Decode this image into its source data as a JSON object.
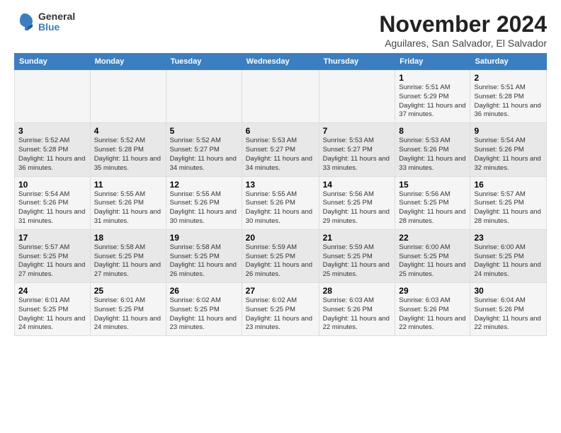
{
  "header": {
    "logo_general": "General",
    "logo_blue": "Blue",
    "month_title": "November 2024",
    "subtitle": "Aguilares, San Salvador, El Salvador"
  },
  "days_of_week": [
    "Sunday",
    "Monday",
    "Tuesday",
    "Wednesday",
    "Thursday",
    "Friday",
    "Saturday"
  ],
  "weeks": [
    [
      {
        "day": "",
        "info": ""
      },
      {
        "day": "",
        "info": ""
      },
      {
        "day": "",
        "info": ""
      },
      {
        "day": "",
        "info": ""
      },
      {
        "day": "",
        "info": ""
      },
      {
        "day": "1",
        "info": "Sunrise: 5:51 AM\nSunset: 5:29 PM\nDaylight: 11 hours\nand 37 minutes."
      },
      {
        "day": "2",
        "info": "Sunrise: 5:51 AM\nSunset: 5:28 PM\nDaylight: 11 hours\nand 36 minutes."
      }
    ],
    [
      {
        "day": "3",
        "info": "Sunrise: 5:52 AM\nSunset: 5:28 PM\nDaylight: 11 hours\nand 36 minutes."
      },
      {
        "day": "4",
        "info": "Sunrise: 5:52 AM\nSunset: 5:28 PM\nDaylight: 11 hours\nand 35 minutes."
      },
      {
        "day": "5",
        "info": "Sunrise: 5:52 AM\nSunset: 5:27 PM\nDaylight: 11 hours\nand 34 minutes."
      },
      {
        "day": "6",
        "info": "Sunrise: 5:53 AM\nSunset: 5:27 PM\nDaylight: 11 hours\nand 34 minutes."
      },
      {
        "day": "7",
        "info": "Sunrise: 5:53 AM\nSunset: 5:27 PM\nDaylight: 11 hours\nand 33 minutes."
      },
      {
        "day": "8",
        "info": "Sunrise: 5:53 AM\nSunset: 5:26 PM\nDaylight: 11 hours\nand 33 minutes."
      },
      {
        "day": "9",
        "info": "Sunrise: 5:54 AM\nSunset: 5:26 PM\nDaylight: 11 hours\nand 32 minutes."
      }
    ],
    [
      {
        "day": "10",
        "info": "Sunrise: 5:54 AM\nSunset: 5:26 PM\nDaylight: 11 hours\nand 31 minutes."
      },
      {
        "day": "11",
        "info": "Sunrise: 5:55 AM\nSunset: 5:26 PM\nDaylight: 11 hours\nand 31 minutes."
      },
      {
        "day": "12",
        "info": "Sunrise: 5:55 AM\nSunset: 5:26 PM\nDaylight: 11 hours\nand 30 minutes."
      },
      {
        "day": "13",
        "info": "Sunrise: 5:55 AM\nSunset: 5:26 PM\nDaylight: 11 hours\nand 30 minutes."
      },
      {
        "day": "14",
        "info": "Sunrise: 5:56 AM\nSunset: 5:25 PM\nDaylight: 11 hours\nand 29 minutes."
      },
      {
        "day": "15",
        "info": "Sunrise: 5:56 AM\nSunset: 5:25 PM\nDaylight: 11 hours\nand 28 minutes."
      },
      {
        "day": "16",
        "info": "Sunrise: 5:57 AM\nSunset: 5:25 PM\nDaylight: 11 hours\nand 28 minutes."
      }
    ],
    [
      {
        "day": "17",
        "info": "Sunrise: 5:57 AM\nSunset: 5:25 PM\nDaylight: 11 hours\nand 27 minutes."
      },
      {
        "day": "18",
        "info": "Sunrise: 5:58 AM\nSunset: 5:25 PM\nDaylight: 11 hours\nand 27 minutes."
      },
      {
        "day": "19",
        "info": "Sunrise: 5:58 AM\nSunset: 5:25 PM\nDaylight: 11 hours\nand 26 minutes."
      },
      {
        "day": "20",
        "info": "Sunrise: 5:59 AM\nSunset: 5:25 PM\nDaylight: 11 hours\nand 26 minutes."
      },
      {
        "day": "21",
        "info": "Sunrise: 5:59 AM\nSunset: 5:25 PM\nDaylight: 11 hours\nand 25 minutes."
      },
      {
        "day": "22",
        "info": "Sunrise: 6:00 AM\nSunset: 5:25 PM\nDaylight: 11 hours\nand 25 minutes."
      },
      {
        "day": "23",
        "info": "Sunrise: 6:00 AM\nSunset: 5:25 PM\nDaylight: 11 hours\nand 24 minutes."
      }
    ],
    [
      {
        "day": "24",
        "info": "Sunrise: 6:01 AM\nSunset: 5:25 PM\nDaylight: 11 hours\nand 24 minutes."
      },
      {
        "day": "25",
        "info": "Sunrise: 6:01 AM\nSunset: 5:25 PM\nDaylight: 11 hours\nand 24 minutes."
      },
      {
        "day": "26",
        "info": "Sunrise: 6:02 AM\nSunset: 5:25 PM\nDaylight: 11 hours\nand 23 minutes."
      },
      {
        "day": "27",
        "info": "Sunrise: 6:02 AM\nSunset: 5:25 PM\nDaylight: 11 hours\nand 23 minutes."
      },
      {
        "day": "28",
        "info": "Sunrise: 6:03 AM\nSunset: 5:26 PM\nDaylight: 11 hours\nand 22 minutes."
      },
      {
        "day": "29",
        "info": "Sunrise: 6:03 AM\nSunset: 5:26 PM\nDaylight: 11 hours\nand 22 minutes."
      },
      {
        "day": "30",
        "info": "Sunrise: 6:04 AM\nSunset: 5:26 PM\nDaylight: 11 hours\nand 22 minutes."
      }
    ]
  ]
}
